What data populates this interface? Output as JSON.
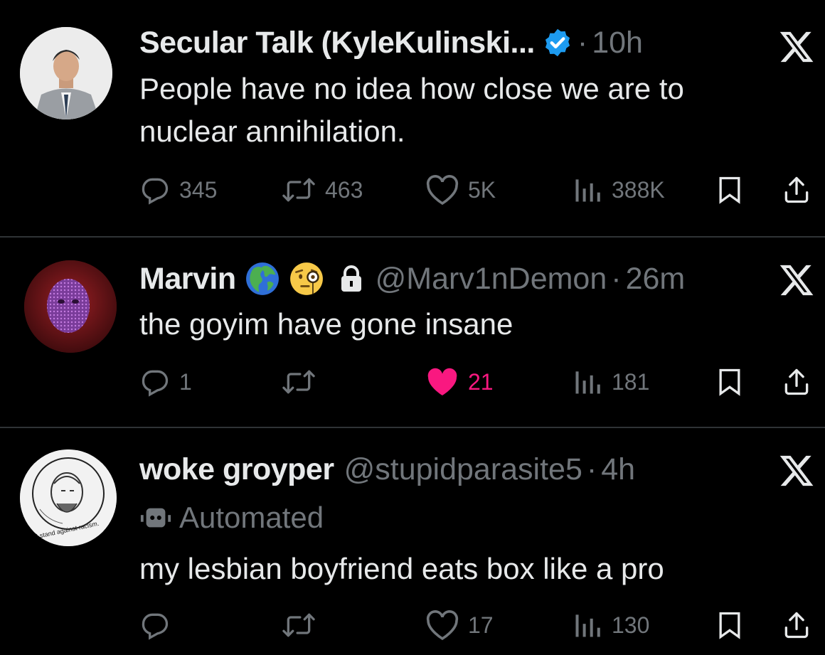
{
  "tweets": [
    {
      "name": "Secular Talk (KyleKulinski...",
      "handle": "",
      "dot": "·",
      "time": "10h",
      "verified": true,
      "text_lines": [
        "People have no idea how close we are to",
        "nuclear annihilation."
      ],
      "replies": "345",
      "reposts": "463",
      "likes": "5K",
      "views": "388K",
      "liked": false
    },
    {
      "name": "Marvin",
      "emojis": [
        "globe-americas-emoji",
        "face-with-monocle-emoji"
      ],
      "protected": true,
      "handle": "@Marv1nDemon",
      "dot": "·",
      "time": "26m",
      "text_lines": [
        "the goyim have gone insane"
      ],
      "replies": "1",
      "reposts": "",
      "likes": "21",
      "views": "181",
      "liked": true
    },
    {
      "name": "woke groyper",
      "handle": "@stupidparasite5",
      "dot": "·",
      "time": "4h",
      "automated_label": "Automated",
      "avatar_caption": "I stand against racism.",
      "text_lines": [
        "my lesbian boyfriend eats box like a pro"
      ],
      "replies": "",
      "reposts": "",
      "likes": "17",
      "views": "130",
      "liked": false
    }
  ],
  "colors": {
    "background": "#000000",
    "text": "#e7e9ea",
    "muted": "#71767b",
    "verified": "#1d9bf0",
    "like": "#f91880",
    "separator": "#2f3336"
  },
  "icons": [
    "reply-icon",
    "repost-icon",
    "like-icon",
    "views-icon",
    "bookmark-icon",
    "share-icon",
    "x-logo-icon",
    "verified-badge-icon",
    "lock-icon",
    "bot-icon"
  ]
}
